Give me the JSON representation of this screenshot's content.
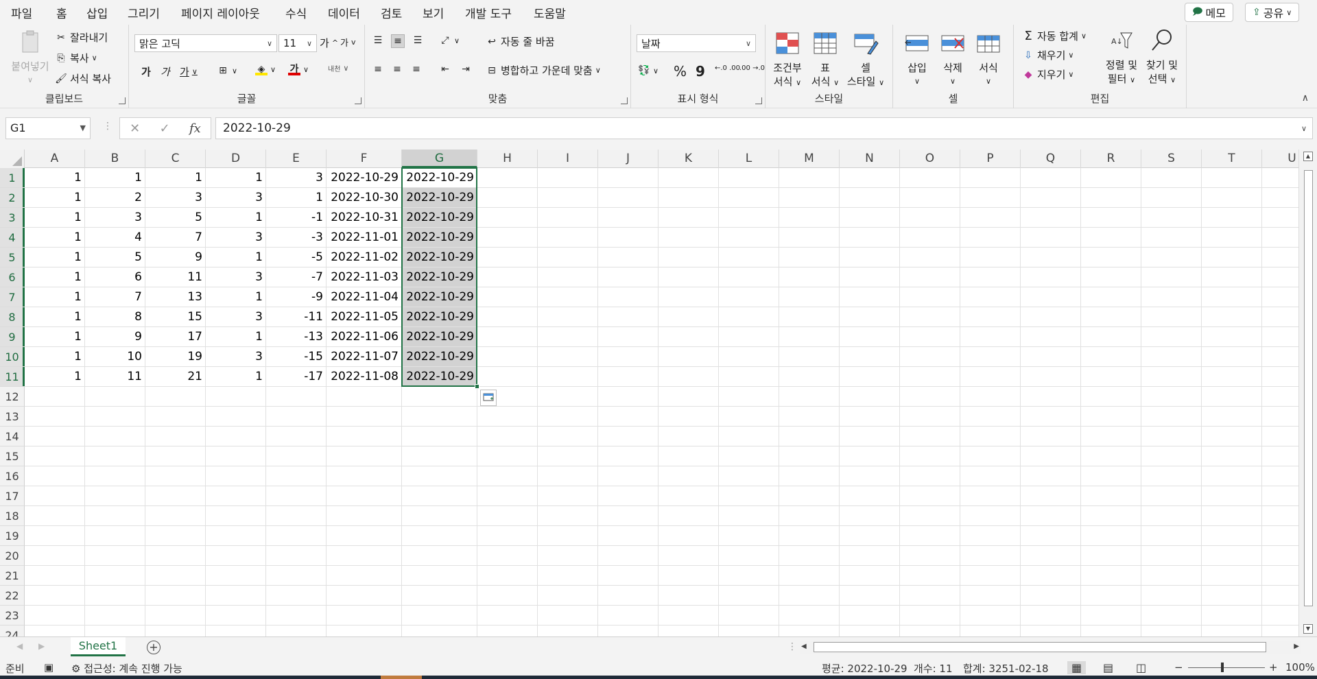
{
  "menu": {
    "tabs": [
      "파일",
      "홈",
      "삽입",
      "그리기",
      "페이지 레이아웃",
      "수식",
      "데이터",
      "검토",
      "보기",
      "개발 도구",
      "도움말"
    ],
    "active_tab": "홈",
    "memo_label": "메모",
    "share_label": "공유"
  },
  "ribbon": {
    "clipboard": {
      "label": "클립보드",
      "paste": "붙여넣기",
      "cut": "잘라내기",
      "copy": "복사",
      "format_painter": "서식 복사"
    },
    "font": {
      "label": "글꼴",
      "font_name": "맑은 고딕",
      "font_size": "11",
      "grow": "가",
      "shrink": "가",
      "bold": "가",
      "italic": "가",
      "underline": "가",
      "phonetic": "내천"
    },
    "alignment": {
      "label": "맞춤",
      "wrap_text": "자동 줄 바꿈",
      "merge_center": "병합하고 가운데 맞춤"
    },
    "number": {
      "label": "표시 형식",
      "format": "날짜",
      "percent": "%",
      "comma": "9",
      "inc_decimal": "←.0 .00",
      "dec_decimal": ".00 →.0"
    },
    "styles": {
      "label": "스타일",
      "conditional_line1": "조건부",
      "conditional_line2": "서식",
      "table_line1": "표",
      "table_line2": "서식",
      "cell_line1": "셀",
      "cell_line2": "스타일"
    },
    "cells": {
      "label": "셀",
      "insert": "삽입",
      "delete": "삭제",
      "format": "서식"
    },
    "editing": {
      "label": "편집",
      "autosum": "자동 합계",
      "fill": "채우기",
      "clear": "지우기",
      "sort_line1": "정렬 및",
      "sort_line2": "필터",
      "find_line1": "찾기 및",
      "find_line2": "선택"
    }
  },
  "formula_bar": {
    "name_box": "G1",
    "cancel": "✕",
    "enter": "✓",
    "fx": "fx",
    "value": "2022-10-29"
  },
  "sheet": {
    "columns": [
      "A",
      "B",
      "C",
      "D",
      "E",
      "F",
      "G",
      "H",
      "I",
      "J",
      "K",
      "L",
      "M",
      "N",
      "O",
      "P",
      "Q",
      "R",
      "S",
      "T",
      "U"
    ],
    "row_numbers": [
      "1",
      "2",
      "3",
      "4",
      "5",
      "6",
      "7",
      "8",
      "9",
      "10",
      "11",
      "12",
      "13",
      "14",
      "15",
      "16",
      "17",
      "18",
      "19",
      "20",
      "21",
      "22",
      "23",
      "24"
    ],
    "rows": [
      [
        "1",
        "1",
        "1",
        "1",
        "3",
        "2022-10-29",
        "2022-10-29"
      ],
      [
        "1",
        "2",
        "3",
        "3",
        "1",
        "2022-10-30",
        "2022-10-29"
      ],
      [
        "1",
        "3",
        "5",
        "1",
        "-1",
        "2022-10-31",
        "2022-10-29"
      ],
      [
        "1",
        "4",
        "7",
        "3",
        "-3",
        "2022-11-01",
        "2022-10-29"
      ],
      [
        "1",
        "5",
        "9",
        "1",
        "-5",
        "2022-11-02",
        "2022-10-29"
      ],
      [
        "1",
        "6",
        "11",
        "3",
        "-7",
        "2022-11-03",
        "2022-10-29"
      ],
      [
        "1",
        "7",
        "13",
        "1",
        "-9",
        "2022-11-04",
        "2022-10-29"
      ],
      [
        "1",
        "8",
        "15",
        "3",
        "-11",
        "2022-11-05",
        "2022-10-29"
      ],
      [
        "1",
        "9",
        "17",
        "1",
        "-13",
        "2022-11-06",
        "2022-10-29"
      ],
      [
        "1",
        "10",
        "19",
        "3",
        "-15",
        "2022-11-07",
        "2022-10-29"
      ],
      [
        "1",
        "11",
        "21",
        "1",
        "-17",
        "2022-11-08",
        "2022-10-29"
      ]
    ],
    "selected_column": "G",
    "selected_rows": [
      "1",
      "2",
      "3",
      "4",
      "5",
      "6",
      "7",
      "8",
      "9",
      "10",
      "11"
    ]
  },
  "tabs_bar": {
    "sheet_name": "Sheet1",
    "add": "+"
  },
  "status": {
    "ready": "준비",
    "accessibility": "접근성: 계속 진행 가능",
    "average": "평균: 2022-10-29",
    "count": "개수: 11",
    "sum": "합계: 3251-02-18",
    "zoom": "100%"
  },
  "colors": {
    "accent": "#217346",
    "selection_fill": "#d2d2d2"
  }
}
